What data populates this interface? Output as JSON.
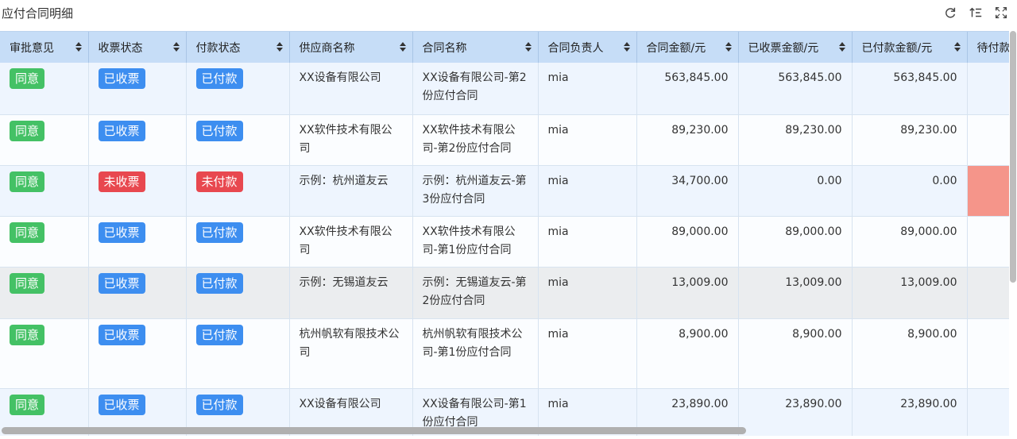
{
  "title": "应付合同明细",
  "toolbar": {
    "icons": [
      "refresh-icon",
      "sort-list-icon",
      "fullscreen-icon"
    ]
  },
  "columns": [
    "审批意见",
    "收票状态",
    "付款状态",
    "供应商名称",
    "合同名称",
    "合同负责人",
    "合同金额/元",
    "已收票金额/元",
    "已付款金额/元",
    "待付款"
  ],
  "rows": [
    {
      "approval": "同意",
      "invoice": "已收票",
      "payment": "已付款",
      "supplier": "XX设备有限公司",
      "contract": "XX设备有限公司-第2份应付合同",
      "owner": "mia",
      "amount": "563,845.00",
      "invoiced": "563,845.00",
      "paid": "563,845.00",
      "pending": ""
    },
    {
      "approval": "同意",
      "invoice": "已收票",
      "payment": "已付款",
      "supplier": "XX软件技术有限公司",
      "contract": "XX软件技术有限公司-第2份应付合同",
      "owner": "mia",
      "amount": "89,230.00",
      "invoiced": "89,230.00",
      "paid": "89,230.00",
      "pending": ""
    },
    {
      "approval": "同意",
      "invoice": "未收票",
      "payment": "未付款",
      "supplier": "示例：杭州道友云",
      "contract": "示例：杭州道友云-第3份应付合同",
      "owner": "mia",
      "amount": "34,700.00",
      "invoiced": "0.00",
      "paid": "0.00",
      "pending": ""
    },
    {
      "approval": "同意",
      "invoice": "已收票",
      "payment": "已付款",
      "supplier": "XX软件技术有限公司",
      "contract": "XX软件技术有限公司-第1份应付合同",
      "owner": "mia",
      "amount": "89,000.00",
      "invoiced": "89,000.00",
      "paid": "89,000.00",
      "pending": ""
    },
    {
      "approval": "同意",
      "invoice": "已收票",
      "payment": "已付款",
      "supplier": "示例：无锡道友云",
      "contract": "示例：无锡道友云-第2份应付合同",
      "owner": "mia",
      "amount": "13,009.00",
      "invoiced": "13,009.00",
      "paid": "13,009.00",
      "pending": ""
    },
    {
      "approval": "同意",
      "invoice": "已收票",
      "payment": "已付款",
      "supplier": "杭州帆软有限技术公司",
      "contract": "杭州帆软有限技术公司-第1份应付合同",
      "owner": "mia",
      "amount": "8,900.00",
      "invoiced": "8,900.00",
      "paid": "8,900.00",
      "pending": ""
    },
    {
      "approval": "同意",
      "invoice": "已收票",
      "payment": "已付款",
      "supplier": "XX设备有限公司",
      "contract": "XX设备有限公司-第1份应付合同",
      "owner": "mia",
      "amount": "23,890.00",
      "invoiced": "23,890.00",
      "paid": "23,890.00",
      "pending": ""
    }
  ],
  "colors": {
    "green": "#44c165",
    "blue": "#3d8ef0",
    "red": "#e8484f",
    "highlight": "#f5958a",
    "header": "#c6ddf7"
  }
}
